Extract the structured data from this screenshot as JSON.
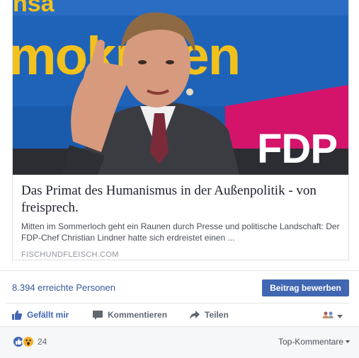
{
  "link_preview": {
    "image_alt": "Christian Lindner speaking at an FDP event",
    "banner_text": "mehr Demokraten",
    "logo_text": "FDP",
    "title": "Das Primat des Humanismus in der Außenpolitik - von freisprech.",
    "description": "Mitten im Sommerloch geht ein Raunen durch Presse und politische Landschaft: Der FDP-Chef Christian Lindner hatte sich erdreistet einen ...",
    "source": "FISCHUNDFLEISCH.COM"
  },
  "reach": {
    "text": "8.394 erreichte Personen",
    "boost_label": "Beitrag bewerben"
  },
  "actions": {
    "like_label": "Gefällt mir",
    "comment_label": "Kommentieren",
    "share_label": "Teilen",
    "audience_icon": "friends-icon"
  },
  "reactions": {
    "types": [
      "like",
      "wow"
    ],
    "count": "24",
    "sort_label": "Top-Kommentare"
  },
  "colors": {
    "accent": "#4267b2",
    "link": "#365899",
    "muted": "#606770",
    "banner_yellow": "#f2c11c",
    "banner_blue": "#1f63b8",
    "banner_magenta": "#d4146b"
  }
}
